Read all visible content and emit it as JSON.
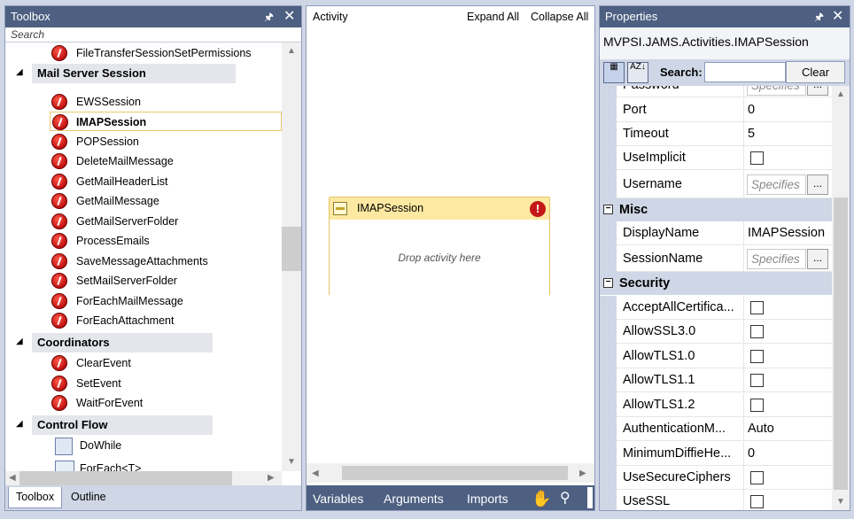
{
  "toolbox": {
    "title": "Toolbox",
    "search_placeholder": "Search",
    "items_top": [
      {
        "label": "FileTransferSessionSetPermissions"
      }
    ],
    "categories": [
      {
        "label": "Mail Server Session"
      },
      {
        "label": "Coordinators"
      },
      {
        "label": "Control Flow"
      }
    ],
    "mail_items": [
      {
        "label": "EWSSession"
      },
      {
        "label": "IMAPSession"
      },
      {
        "label": "POPSession"
      },
      {
        "label": "DeleteMailMessage"
      },
      {
        "label": "GetMailHeaderList"
      },
      {
        "label": "GetMailMessage"
      },
      {
        "label": "GetMailServerFolder"
      },
      {
        "label": "ProcessEmails"
      },
      {
        "label": "SaveMessageAttachments"
      },
      {
        "label": "SetMailServerFolder"
      },
      {
        "label": "ForEachMailMessage"
      },
      {
        "label": "ForEachAttachment"
      }
    ],
    "coord_items": [
      {
        "label": "ClearEvent"
      },
      {
        "label": "SetEvent"
      },
      {
        "label": "WaitForEvent"
      }
    ],
    "flow_items": [
      {
        "label": "DoWhile"
      },
      {
        "label": "ForEach<T>"
      }
    ],
    "tabs": [
      {
        "label": "Toolbox"
      },
      {
        "label": "Outline"
      }
    ]
  },
  "designer": {
    "activity_label": "Activity",
    "expand_all": "Expand All",
    "collapse_all": "Collapse All",
    "activity_title": "IMAPSession",
    "drop_hint": "Drop activity here",
    "bottom": {
      "variables": "Variables",
      "arguments": "Arguments",
      "imports": "Imports"
    }
  },
  "properties": {
    "title": "Properties",
    "object": "MVPSI.JAMS.Activities.IMAPSession",
    "search_label": "Search:",
    "clear": "Clear",
    "rows": [
      {
        "name": "Password",
        "value": "Specifies"
      },
      {
        "name": "Port",
        "value": "0"
      },
      {
        "name": "Timeout",
        "value": "5"
      },
      {
        "name": "UseImplicit",
        "value": ""
      },
      {
        "name": "Username",
        "value": "Specifies"
      }
    ],
    "misc": {
      "label": "Misc",
      "rows": [
        {
          "name": "DisplayName",
          "value": "IMAPSession"
        },
        {
          "name": "SessionName",
          "value": "Specifies"
        }
      ]
    },
    "security": {
      "label": "Security",
      "rows": [
        {
          "name": "AcceptAllCertifica..."
        },
        {
          "name": "AllowSSL3.0"
        },
        {
          "name": "AllowTLS1.0"
        },
        {
          "name": "AllowTLS1.1"
        },
        {
          "name": "AllowTLS1.2"
        },
        {
          "name": "AuthenticationM...",
          "value": "Auto"
        },
        {
          "name": "MinimumDiffieHe...",
          "value": "0"
        },
        {
          "name": "UseSecureCiphers"
        },
        {
          "name": "UseSSL"
        }
      ]
    }
  }
}
